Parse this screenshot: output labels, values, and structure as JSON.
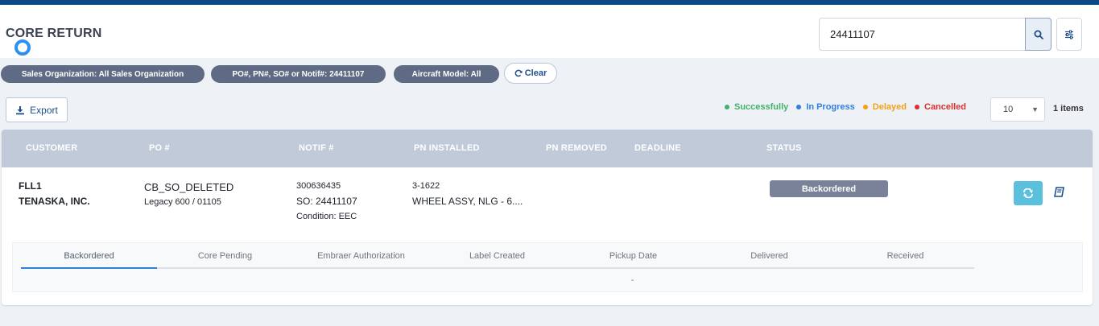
{
  "colors": {
    "accent": "#0a4a86",
    "chip_bg": "#5f6b84",
    "table_header_bg": "#c0cad9",
    "success": "#43b06c",
    "in_progress": "#2f7fe0",
    "delayed": "#f0a11c",
    "cancelled": "#d9322e",
    "status_badge": "#7a8299",
    "action_button": "#5bc0de"
  },
  "header": {
    "title": "CORE RETURN",
    "search_value": "24411107",
    "search_icon": "search-icon",
    "filter_icon": "sliders-icon"
  },
  "filters": {
    "chips": [
      "Sales Organization: All Sales Organization",
      "PO#, PN#, SO# or Notif#: 24411107",
      "Aircraft Model: All"
    ],
    "clear_label": "Clear"
  },
  "toolbar": {
    "export_label": "Export",
    "legend": [
      {
        "label": "Successfully",
        "color": "#43b06c"
      },
      {
        "label": "In Progress",
        "color": "#2f7fe0"
      },
      {
        "label": "Delayed",
        "color": "#f0a11c"
      },
      {
        "label": "Cancelled",
        "color": "#d9322e"
      }
    ],
    "page_size": "10",
    "item_count": "1 items"
  },
  "table": {
    "columns": [
      "CUSTOMER",
      "PO #",
      "NOTIF #",
      "PN INSTALLED",
      "PN REMOVED",
      "DEADLINE",
      "STATUS"
    ],
    "rows": [
      {
        "customer_code": "FLL1",
        "customer_name": "TENASKA, INC.",
        "po": "CB_SO_DELETED",
        "po_sub": "Legacy 600 / 01105",
        "notif": "300636435",
        "so": "SO: 24411107",
        "condition": "Condition: EEC",
        "pn_installed": "3-1622",
        "pn_desc": "WHEEL ASSY, NLG - 6....",
        "status": "Backordered"
      }
    ]
  },
  "tracker": {
    "steps": [
      "Backordered",
      "Core Pending",
      "Embraer Authorization",
      "Label Created",
      "Pickup Date",
      "Delivered",
      "Received"
    ],
    "value": "-"
  }
}
